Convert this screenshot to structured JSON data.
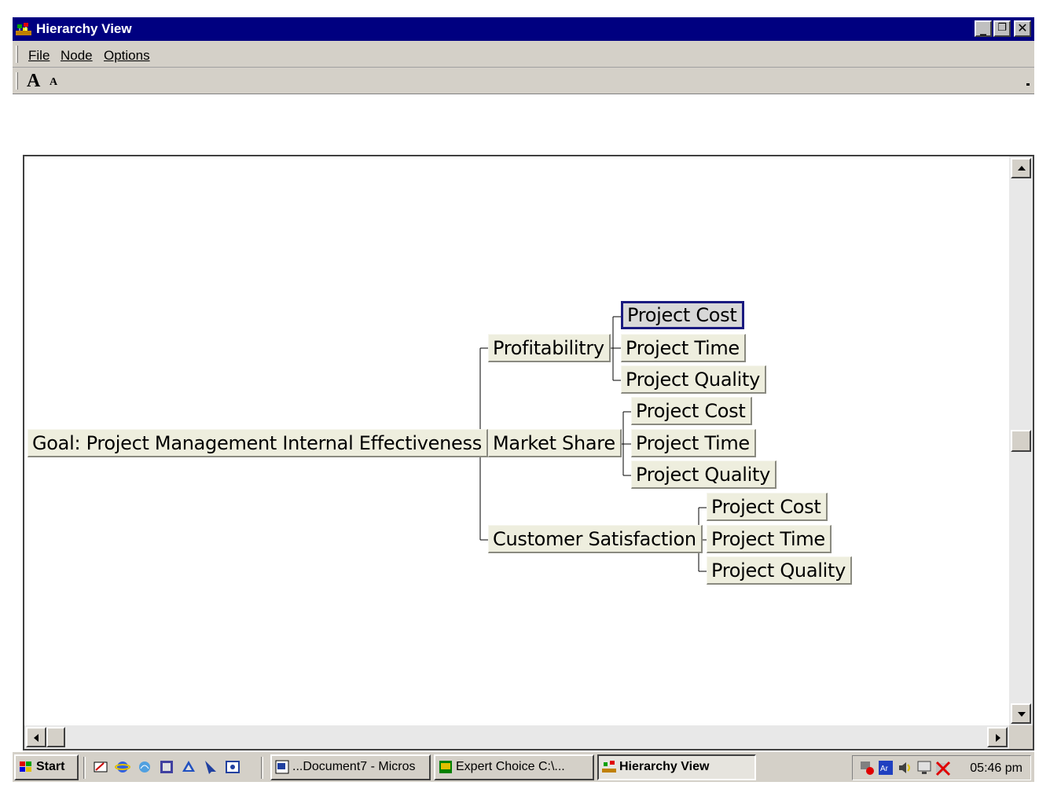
{
  "window": {
    "title": "Hierarchy View"
  },
  "window_controls": {
    "minimize": "_",
    "restore": "❐",
    "close": "✕"
  },
  "menu": {
    "items": [
      "File",
      "Node",
      "Options"
    ]
  },
  "toolbar": {
    "font_increase": "A",
    "font_decrease": "A"
  },
  "hierarchy": {
    "goal": "Goal: Project Management Internal Effectiveness",
    "criteria": [
      {
        "label": "Profitabilitry",
        "children": [
          "Project Cost",
          "Project Time",
          "Project Quality"
        ],
        "selected_child": 0
      },
      {
        "label": "Market Share",
        "children": [
          "Project Cost",
          "Project Time",
          "Project Quality"
        ]
      },
      {
        "label": "Customer Satisfaction",
        "children": [
          "Project Cost",
          "Project Time",
          "Project Quality"
        ]
      }
    ]
  },
  "taskbar": {
    "start_label": "Start",
    "quicklaunch_icons": [
      "outlook-express-icon",
      "internet-explorer-icon",
      "channels-icon",
      "app-icon",
      "app-icon",
      "cursor-icon",
      "app-icon"
    ],
    "tasks": [
      {
        "label": "...Document7 - Micros",
        "icon": "word-icon",
        "active": false
      },
      {
        "label": "Expert Choice   C:\\...",
        "icon": "expert-choice-icon",
        "active": false
      },
      {
        "label": "Hierarchy View",
        "icon": "hierarchy-icon",
        "active": true
      }
    ],
    "clock": "05:46 pm"
  },
  "colors": {
    "titlebar": "#000080",
    "node_bg": "#eeeede",
    "selected_border": "#1a1a80",
    "chrome": "#d4d0c8"
  }
}
